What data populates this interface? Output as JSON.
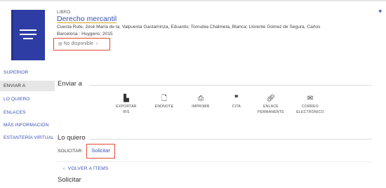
{
  "record": {
    "type_label": "LIBRO",
    "title": "Derecho mercantil",
    "authors_line1": "Cuesta Rute, José María de la; Valpuesta Gastaminza, Eduardo; Tornubia Chalmeta, Blanca; Llorente Gómez de Segura, Carlos",
    "authors_line2": "Barcelona : Huygens; 2015",
    "availability": "No disponible",
    "availability_icon": "book-status-icon",
    "pin_icon": "pin-icon"
  },
  "sidebar": {
    "items": [
      {
        "label": "SUPERIOR"
      },
      {
        "label": "ENVIAR A"
      },
      {
        "label": "LO QUIERO"
      },
      {
        "label": "ENLACES"
      },
      {
        "label": "MÁS INFORMACIÓN"
      },
      {
        "label": "ESTANTERÍA VIRTUAL"
      }
    ]
  },
  "send_to": {
    "heading": "Enviar a",
    "actions": [
      {
        "label1": "EXPORTAR",
        "label2": "RIS",
        "icon": "file-export-icon"
      },
      {
        "label1": "ENDNOTE",
        "label2": "",
        "icon": "document-icon"
      },
      {
        "label1": "IMPRIMIR",
        "label2": "",
        "icon": "printer-icon"
      },
      {
        "label1": "CITA",
        "label2": "",
        "icon": "quote-icon"
      },
      {
        "label1": "ENLACE",
        "label2": "PERMANENTE",
        "icon": "link-icon"
      },
      {
        "label1": "CORREO",
        "label2": "ELECTRÓNICO",
        "icon": "email-icon"
      }
    ]
  },
  "lo_quiero": {
    "heading": "Lo quiero",
    "solicitar_label": "SOLICITAR:",
    "solicitar_button": "Solicitar",
    "back_link": "VOLVER A ÍTEMS",
    "request_title": "Solicitar"
  },
  "colors": {
    "accent": "#3a4fb8",
    "highlight_border": "#e04a3a",
    "book_cover": "#2d3da3"
  }
}
